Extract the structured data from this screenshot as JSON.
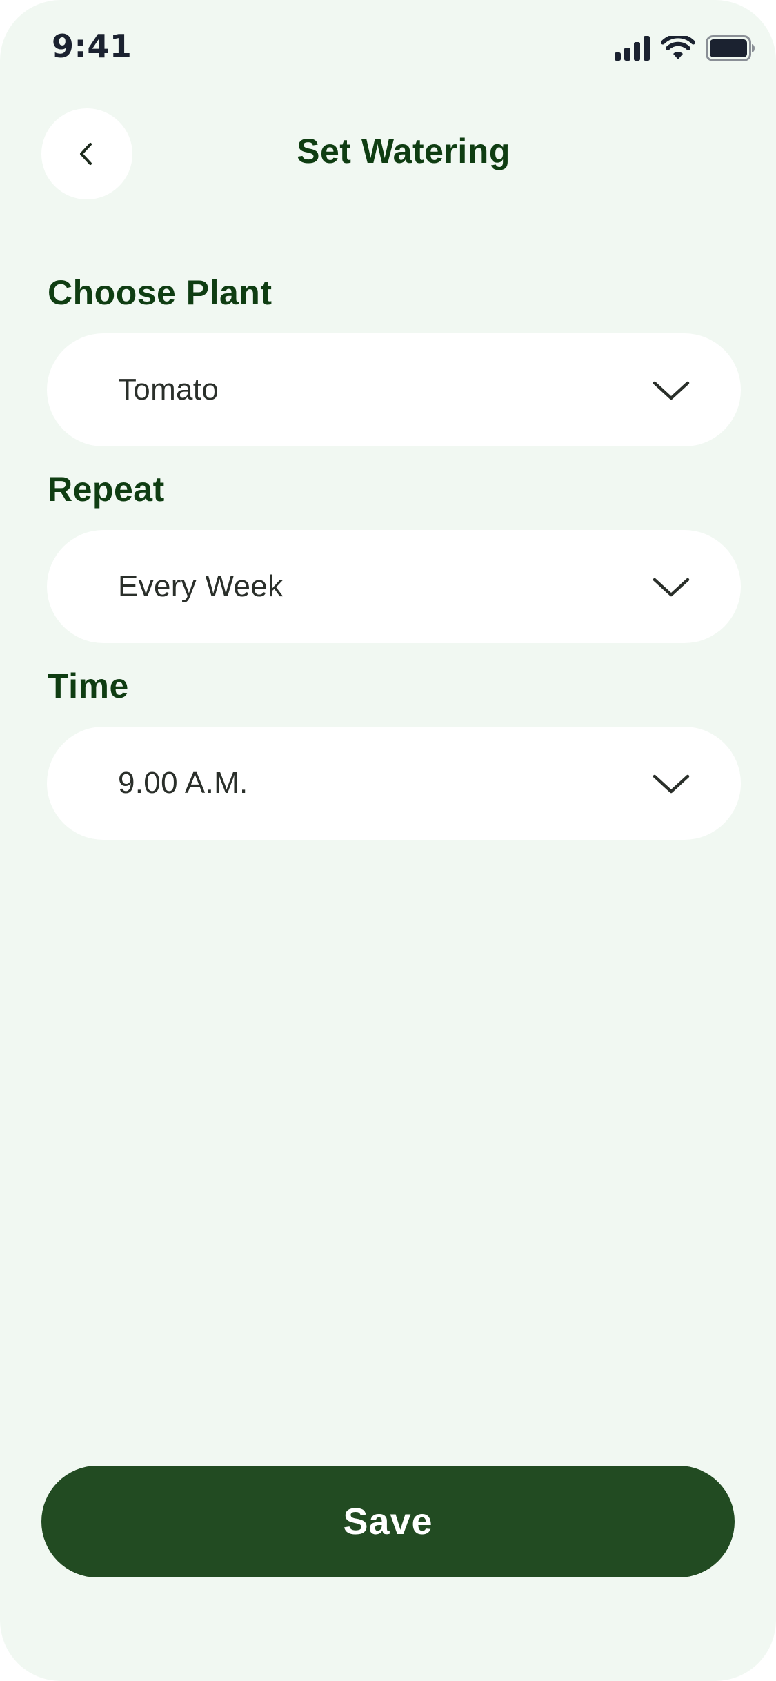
{
  "status_bar": {
    "time": "9:41",
    "icons": [
      "signal-icon",
      "wifi-icon",
      "battery-icon"
    ]
  },
  "header": {
    "back_icon": "chevron-left-icon",
    "title": "Set Watering"
  },
  "form": {
    "plant": {
      "label": "Choose Plant",
      "value": "Tomato"
    },
    "repeat": {
      "label": "Repeat",
      "value": "Every Week"
    },
    "time": {
      "label": "Time",
      "value": "9.00 A.M."
    },
    "dropdown_icon": "chevron-down-icon"
  },
  "actions": {
    "save_label": "Save"
  },
  "colors": {
    "background": "#f1f8f2",
    "primary_dark_green": "#224b22",
    "heading_green": "#0f3d12",
    "surface": "#ffffff",
    "status_text": "#1b2230"
  }
}
